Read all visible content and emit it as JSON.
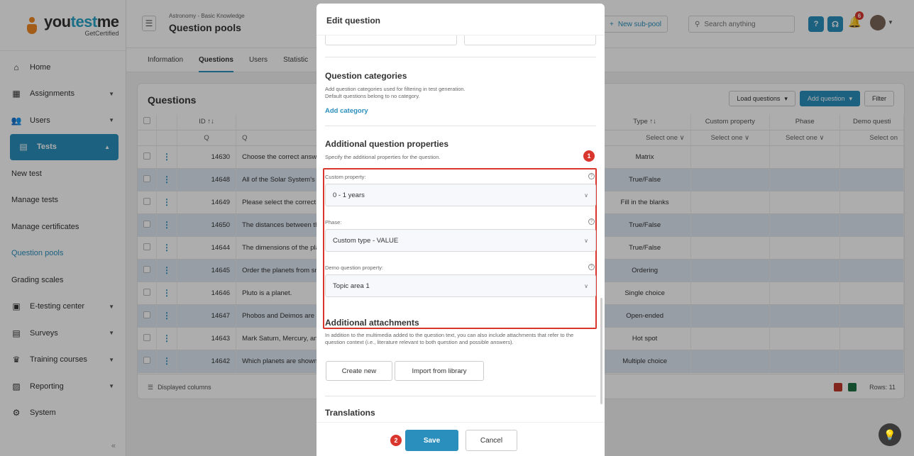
{
  "logo": {
    "name_a": "you",
    "name_b": "test",
    "name_c": "me",
    "sub": "GetCertified"
  },
  "sidebar": {
    "items": [
      {
        "label": "Home",
        "icon": "home-icon",
        "glyph": "⌂"
      },
      {
        "label": "Assignments",
        "icon": "assignments-icon",
        "glyph": "▦"
      },
      {
        "label": "Users",
        "icon": "users-icon",
        "glyph": "👥"
      },
      {
        "label": "Tests",
        "icon": "tests-icon",
        "glyph": "▤"
      }
    ],
    "sub_items": [
      "New test",
      "Manage tests",
      "Manage certificates",
      "Question pools",
      "Grading scales"
    ],
    "lower_items": [
      {
        "label": "E-testing center",
        "icon": "etesting-icon",
        "glyph": "▣"
      },
      {
        "label": "Surveys",
        "icon": "surveys-icon",
        "glyph": "▤"
      },
      {
        "label": "Training courses",
        "icon": "training-icon",
        "glyph": "♛"
      },
      {
        "label": "Reporting",
        "icon": "reporting-icon",
        "glyph": "▨"
      },
      {
        "label": "System",
        "icon": "system-icon",
        "glyph": "⚙"
      }
    ],
    "collapse": "«"
  },
  "header": {
    "breadcrumb": "Astronomy - Basic Knowledge",
    "title": "Question pools",
    "new_subpool": "New sub-pool",
    "search_placeholder": "Search anything",
    "notifications": "6"
  },
  "tabs": [
    "Information",
    "Questions",
    "Users",
    "Statistic"
  ],
  "panel": {
    "title": "Questions",
    "load": "Load questions",
    "add": "Add question",
    "filter": "Filter",
    "columns": {
      "id": "ID ↑↓",
      "type": "Type ↑↓",
      "custom": "Custom property",
      "phase": "Phase",
      "demo": "Demo questi"
    },
    "filter_row": {
      "search": "Q",
      "select": "Select one ∨",
      "select_cut": "Select on"
    },
    "rows": [
      {
        "id": "14630",
        "text": "Choose the correct answer.",
        "type": "Matrix"
      },
      {
        "id": "14648",
        "text": "All of the Solar System's pla",
        "type": "True/False"
      },
      {
        "id": "14649",
        "text": "Please select the correct ar",
        "type": "Fill in the blanks"
      },
      {
        "id": "14650",
        "text": "The distances between the",
        "type": "True/False"
      },
      {
        "id": "14644",
        "text": "The dimensions of the plan",
        "type": "True/False"
      },
      {
        "id": "14645",
        "text": "Order the planets from sma",
        "type": "Ordering"
      },
      {
        "id": "14646",
        "text": "Pluto is a planet.",
        "type": "Single choice"
      },
      {
        "id": "14647",
        "text": "Phobos and Deimos are mo",
        "type": "Open-ended"
      },
      {
        "id": "14643",
        "text": "Mark Saturn, Mercury, and N",
        "type": "Hot spot"
      },
      {
        "id": "14642",
        "text": "Which planets are shown in",
        "type": "Multiple choice"
      }
    ],
    "displayed_columns": "Displayed columns",
    "rows_count": "Rows: 11"
  },
  "modal": {
    "title": "Edit question",
    "categories_title": "Question categories",
    "categories_desc": "Add question categories used for filtering in test generation.\nDefault questions belong to no category.",
    "add_category": "Add category",
    "props_title": "Additional question properties",
    "props_desc": "Specify the additional properties for the question.",
    "custom_label": "Custom property:",
    "custom_value": "0 - 1 years",
    "phase_label": "Phase:",
    "phase_value": "Custom type - VALUE",
    "demo_label": "Demo question property:",
    "demo_value": "Topic area 1",
    "attach_title": "Additional attachments",
    "attach_desc": "In addition to the multimedia added to the question text, you can also include attachments that refer to the question context (i.e., literature relevant to both question and possible answers).",
    "create_new": "Create new",
    "import": "Import from library",
    "translations_title": "Translations",
    "save": "Save",
    "cancel": "Cancel",
    "marker1": "1",
    "marker2": "2"
  },
  "colors": {
    "accent": "#2a8fbd",
    "highlight": "#d9362e",
    "logo": "#f08a24"
  }
}
